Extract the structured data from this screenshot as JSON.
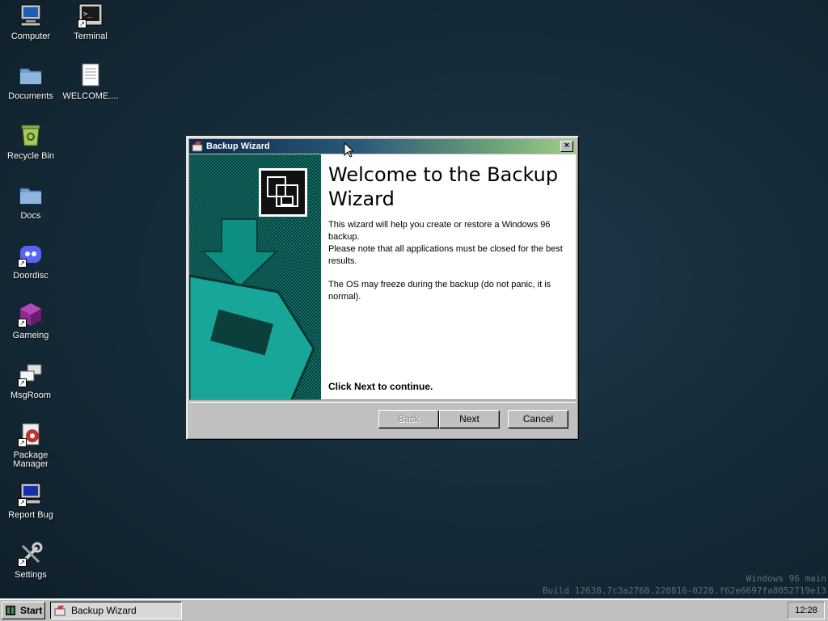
{
  "desktop": {
    "icons": [
      {
        "label": "Computer",
        "icon": "computer-icon"
      },
      {
        "label": "Terminal",
        "icon": "terminal-icon"
      },
      {
        "label": "Documents",
        "icon": "folder-icon"
      },
      {
        "label": "WELCOME....",
        "icon": "text-file-icon"
      },
      {
        "label": "Recycle Bin",
        "icon": "recycle-bin-icon"
      },
      {
        "label": "Docs",
        "icon": "folder-icon"
      },
      {
        "label": "Doordisc",
        "icon": "doordisc-icon"
      },
      {
        "label": "Gameing",
        "icon": "game-cube-icon"
      },
      {
        "label": "MsgRoom",
        "icon": "chat-icon"
      },
      {
        "label": "Package\nManager",
        "icon": "package-manager-icon"
      },
      {
        "label": "Report Bug",
        "icon": "report-bug-icon"
      },
      {
        "label": "Settings",
        "icon": "settings-icon"
      }
    ],
    "watermark": {
      "line1": "Windows 96 main",
      "line2": "Build 12638.7c3a2768.220816-0228.f62e6697fa8052719e13"
    }
  },
  "wizard": {
    "title": "Backup Wizard",
    "heading": "Welcome to the Backup Wizard",
    "para1": "This wizard will help you create or restore a Windows 96 backup.",
    "para2": "Please note that all applications must be closed for the best results.",
    "para3": "The OS may freeze during the backup (do not panic, it is normal).",
    "continue_hint": "Click Next to continue.",
    "buttons": {
      "back": "Back",
      "next": "Next",
      "cancel": "Cancel"
    },
    "close_label": "×",
    "sidebar_color": "#0e6f67"
  },
  "taskbar": {
    "start_label": "Start",
    "task_label": "Backup Wizard",
    "clock": "12:28"
  }
}
